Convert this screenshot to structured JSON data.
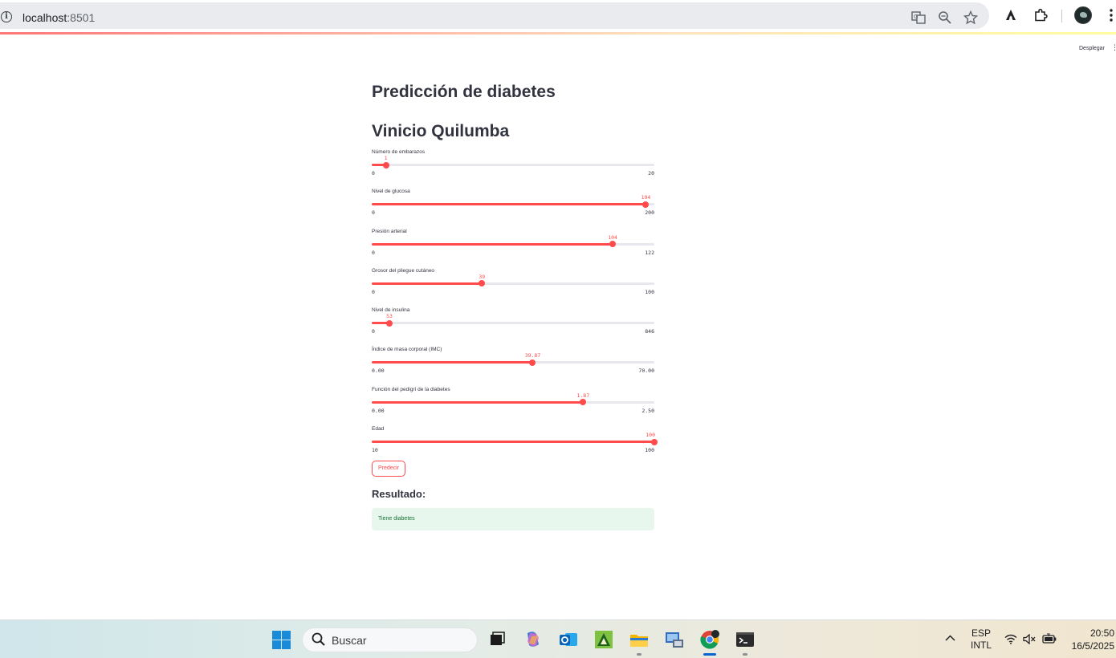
{
  "browser": {
    "url_host": "localhost",
    "url_port": ":8501",
    "icons": [
      "info-icon",
      "translate-icon",
      "zoom-icon",
      "star-icon",
      "extension-a-icon",
      "puzzle-icon",
      "avatar",
      "more-vert-icon"
    ]
  },
  "app_header": {
    "deploy_label": "Desplegar"
  },
  "main": {
    "title": "Predicción de diabetes",
    "author": "Vinicio Quilumba",
    "sliders": [
      {
        "label": "Número de embarazos",
        "value": 1,
        "value_text": "1",
        "min": 0,
        "max": 20,
        "min_text": "0",
        "max_text": "20"
      },
      {
        "label": "Nivel de glucosa",
        "value": 194,
        "value_text": "194",
        "min": 0,
        "max": 200,
        "min_text": "0",
        "max_text": "200"
      },
      {
        "label": "Presión arterial",
        "value": 104,
        "value_text": "104",
        "min": 0,
        "max": 122,
        "min_text": "0",
        "max_text": "122"
      },
      {
        "label": "Grosor del pliegue cutáneo",
        "value": 39,
        "value_text": "39",
        "min": 0,
        "max": 100,
        "min_text": "0",
        "max_text": "100"
      },
      {
        "label": "Nivel de insulina",
        "value": 53,
        "value_text": "53",
        "min": 0,
        "max": 846,
        "min_text": "0",
        "max_text": "846"
      },
      {
        "label": "Índice de masa corporal (IMC)",
        "value": 39.87,
        "value_text": "39.87",
        "min": 0,
        "max": 70,
        "min_text": "0.00",
        "max_text": "70.00"
      },
      {
        "label": "Función del pedigrí de la diabetes",
        "value": 1.87,
        "value_text": "1.87",
        "min": 0,
        "max": 2.5,
        "min_text": "0.00",
        "max_text": "2.50"
      },
      {
        "label": "Edad",
        "value": 100,
        "value_text": "100",
        "min": 10,
        "max": 100,
        "min_text": "10",
        "max_text": "100"
      }
    ],
    "predict_button": "Predecir",
    "result_heading": "Resultado:",
    "result_text": "Tiene diabetes",
    "accent_color": "#ff4b4b",
    "success_bg": "#e8f7ee"
  },
  "taskbar": {
    "search_placeholder": "Buscar",
    "language_top": "ESP",
    "language_bottom": "INTL",
    "time": "20:50",
    "date": "16/5/2025"
  }
}
